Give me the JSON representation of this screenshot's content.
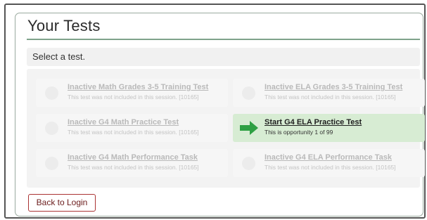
{
  "page": {
    "title": "Your Tests",
    "instruction": "Select a test."
  },
  "tests": [
    {
      "name": "Inactive Math Grades 3-5 Training Test",
      "desc": "This test was not included in this session. [10165]",
      "active": false
    },
    {
      "name": "Inactive ELA Grades 3-5 Training Test",
      "desc": "This test was not included in this session. [10165]",
      "active": false
    },
    {
      "name": "Inactive G4 Math Practice Test",
      "desc": "This test was not included in this session. [10165]",
      "active": false
    },
    {
      "name": "Start G4 ELA Practice Test",
      "desc": "This is opportunity 1 of 99",
      "active": true
    },
    {
      "name": "Inactive G4 Math Performance Task",
      "desc": "This test was not included in this session. [10165]",
      "active": false
    },
    {
      "name": "Inactive G4 ELA Performance Task",
      "desc": "This test was not included in this session. [10165]",
      "active": false
    }
  ],
  "footer": {
    "back_label": "Back to Login"
  },
  "colors": {
    "accent_green": "#2ea043",
    "active_tile_bg": "#d7ecd3",
    "back_button_border": "#aa3333"
  },
  "icons": {
    "start": "right-arrow-icon",
    "inactive": "circle-icon"
  }
}
